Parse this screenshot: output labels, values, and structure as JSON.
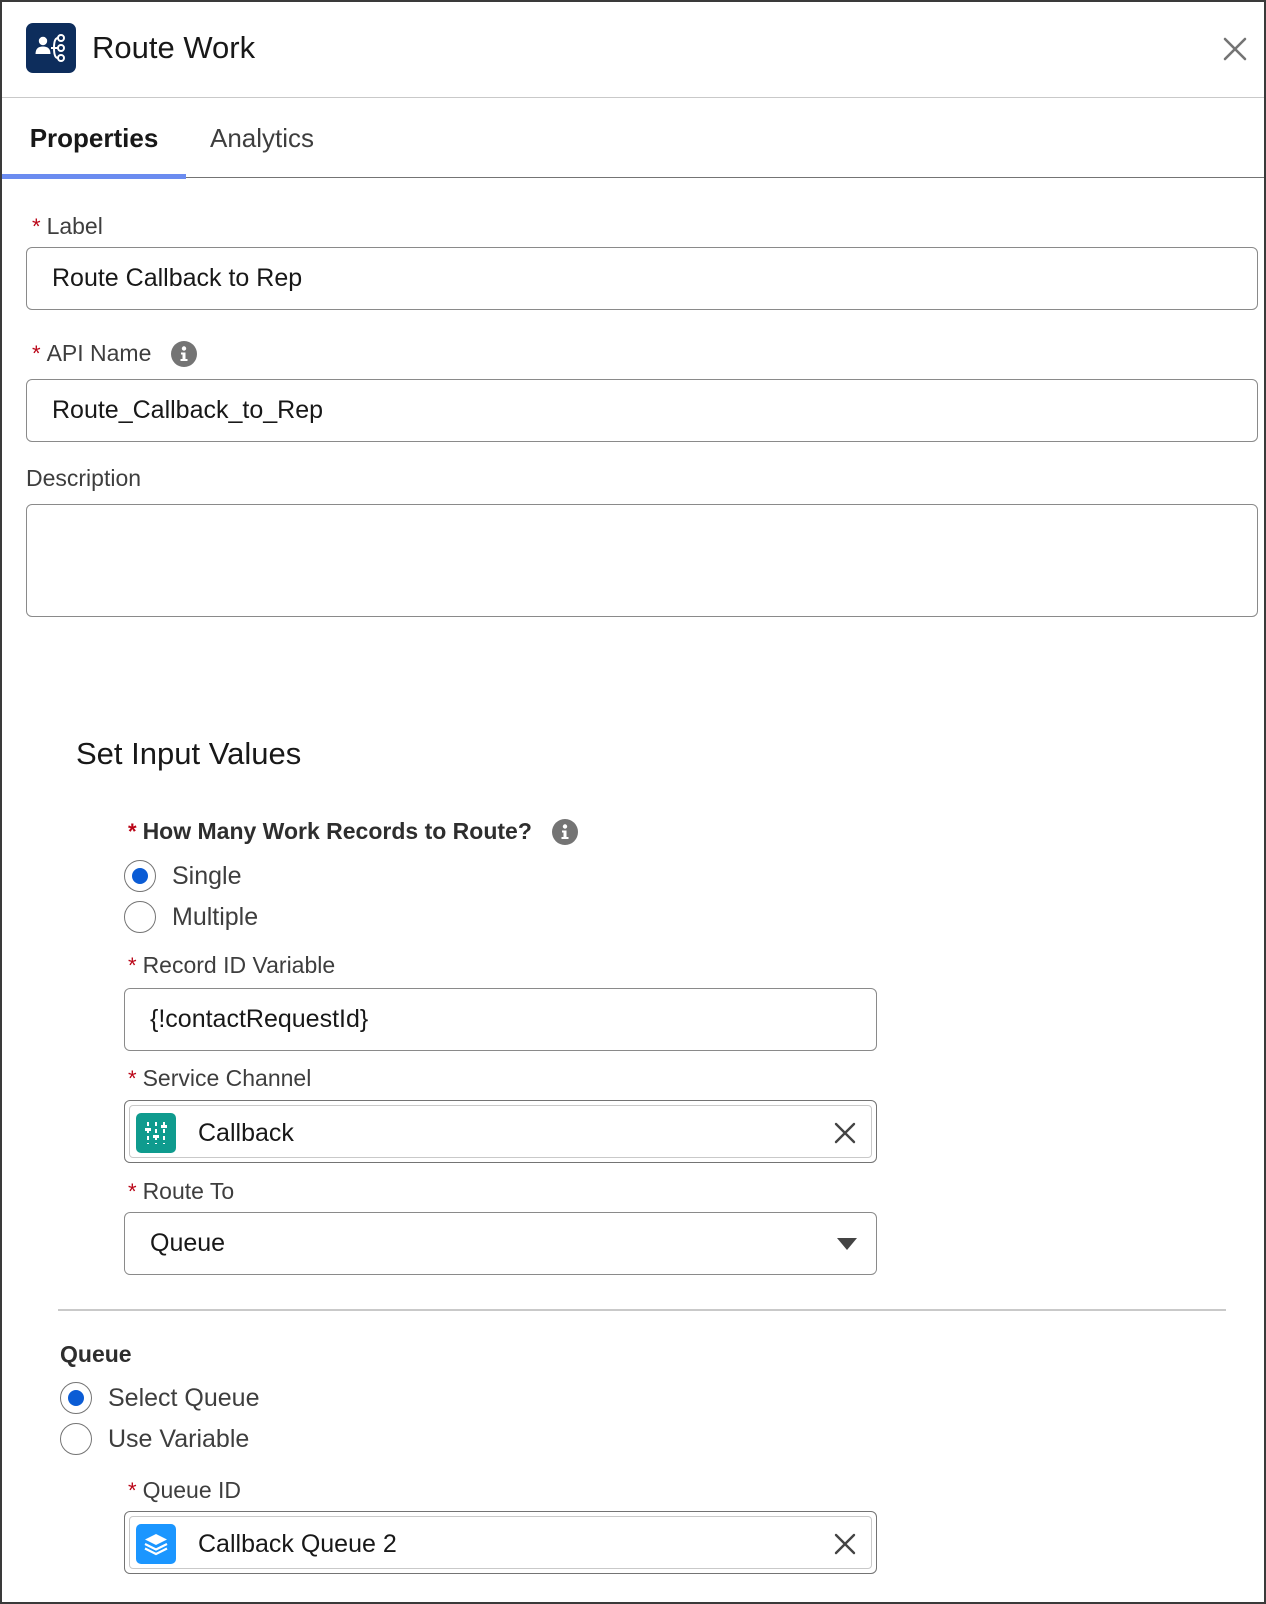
{
  "header": {
    "title": "Route Work",
    "icon": "route-work-icon"
  },
  "tabs": [
    {
      "label": "Properties",
      "active": true
    },
    {
      "label": "Analytics",
      "active": false
    }
  ],
  "fields": {
    "label": {
      "label": "Label",
      "value": "Route Callback to Rep"
    },
    "api_name": {
      "label": "API Name",
      "value": "Route_Callback_to_Rep"
    },
    "description": {
      "label": "Description",
      "value": ""
    }
  },
  "input_values": {
    "title": "Set Input Values",
    "how_many": {
      "label": "How Many Work Records to Route?",
      "options": [
        {
          "label": "Single",
          "checked": true
        },
        {
          "label": "Multiple",
          "checked": false
        }
      ]
    },
    "record_id": {
      "label": "Record ID Variable",
      "value": "{!contactRequestId}"
    },
    "service_channel": {
      "label": "Service Channel",
      "value": "Callback",
      "icon": "service-channel-icon",
      "icon_color": "#0f9b8e"
    },
    "route_to": {
      "label": "Route To",
      "value": "Queue"
    }
  },
  "queue": {
    "title": "Queue",
    "options": [
      {
        "label": "Select Queue",
        "checked": true
      },
      {
        "label": "Use Variable",
        "checked": false
      }
    ],
    "queue_id": {
      "label": "Queue ID",
      "value": "Callback Queue 2",
      "icon": "queue-icon",
      "icon_color": "#1b96ff"
    }
  },
  "colors": {
    "required": "#ba0517",
    "radio_selected": "#0b5cd5",
    "tab_active": "#6b8cf0",
    "header_icon_bg": "#0d2d5c"
  }
}
